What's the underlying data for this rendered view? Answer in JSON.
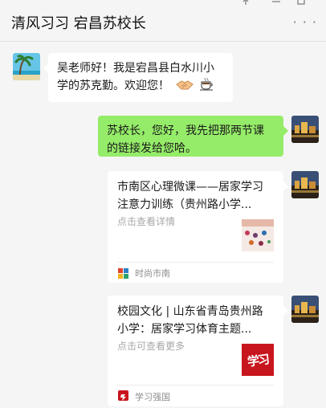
{
  "window": {
    "title": "清风习习 宕昌苏校长",
    "pin_icon": "pin-icon",
    "minimize_icon": "minimize-icon",
    "maximize_icon": "maximize-icon",
    "more_icon": "more-icon"
  },
  "messages": [
    {
      "side": "left",
      "text": "吴老师好！我是宕昌县白水川小学的苏克勤。欢迎您！",
      "emoji": [
        "handshake-icon",
        "coffee-icon"
      ]
    },
    {
      "side": "right",
      "text": "苏校长，您好，我先把那两节课的链接发给您哈。"
    },
    {
      "side": "right",
      "type": "link-card",
      "title": "市南区心理微课——居家学习注意力训练（贵州路小学...",
      "desc": "点击查看详情",
      "source": "时尚市南"
    },
    {
      "side": "right",
      "type": "link-card",
      "title": "校园文化 | 山东省青岛贵州路小学：居家学习体育主题...",
      "desc": "点击可查看更多",
      "source": "学习强国",
      "thumb_text": "学习"
    }
  ],
  "colors": {
    "background": "#f5f5f5",
    "my_bubble": "#95ec69",
    "their_bubble": "#ffffff",
    "xuexi_red": "#c8161e"
  }
}
